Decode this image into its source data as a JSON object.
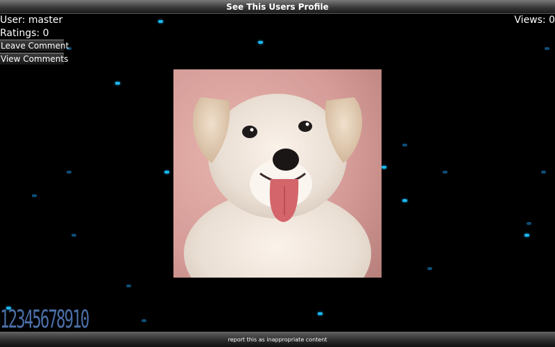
{
  "header": {
    "title": "See This Users Profile"
  },
  "profile": {
    "user_text": "User: master",
    "ratings_text": "Ratings: 0",
    "views_text": "Views: 0"
  },
  "actions": {
    "leave_comment": "Leave Comment",
    "view_comments": "View Comments"
  },
  "background": {
    "digits": "12345678910",
    "dot_color": "#19b8f0"
  },
  "footer": {
    "report_text": "report this as inappropriate content"
  },
  "photo": {
    "icon": "puppy-photo"
  }
}
